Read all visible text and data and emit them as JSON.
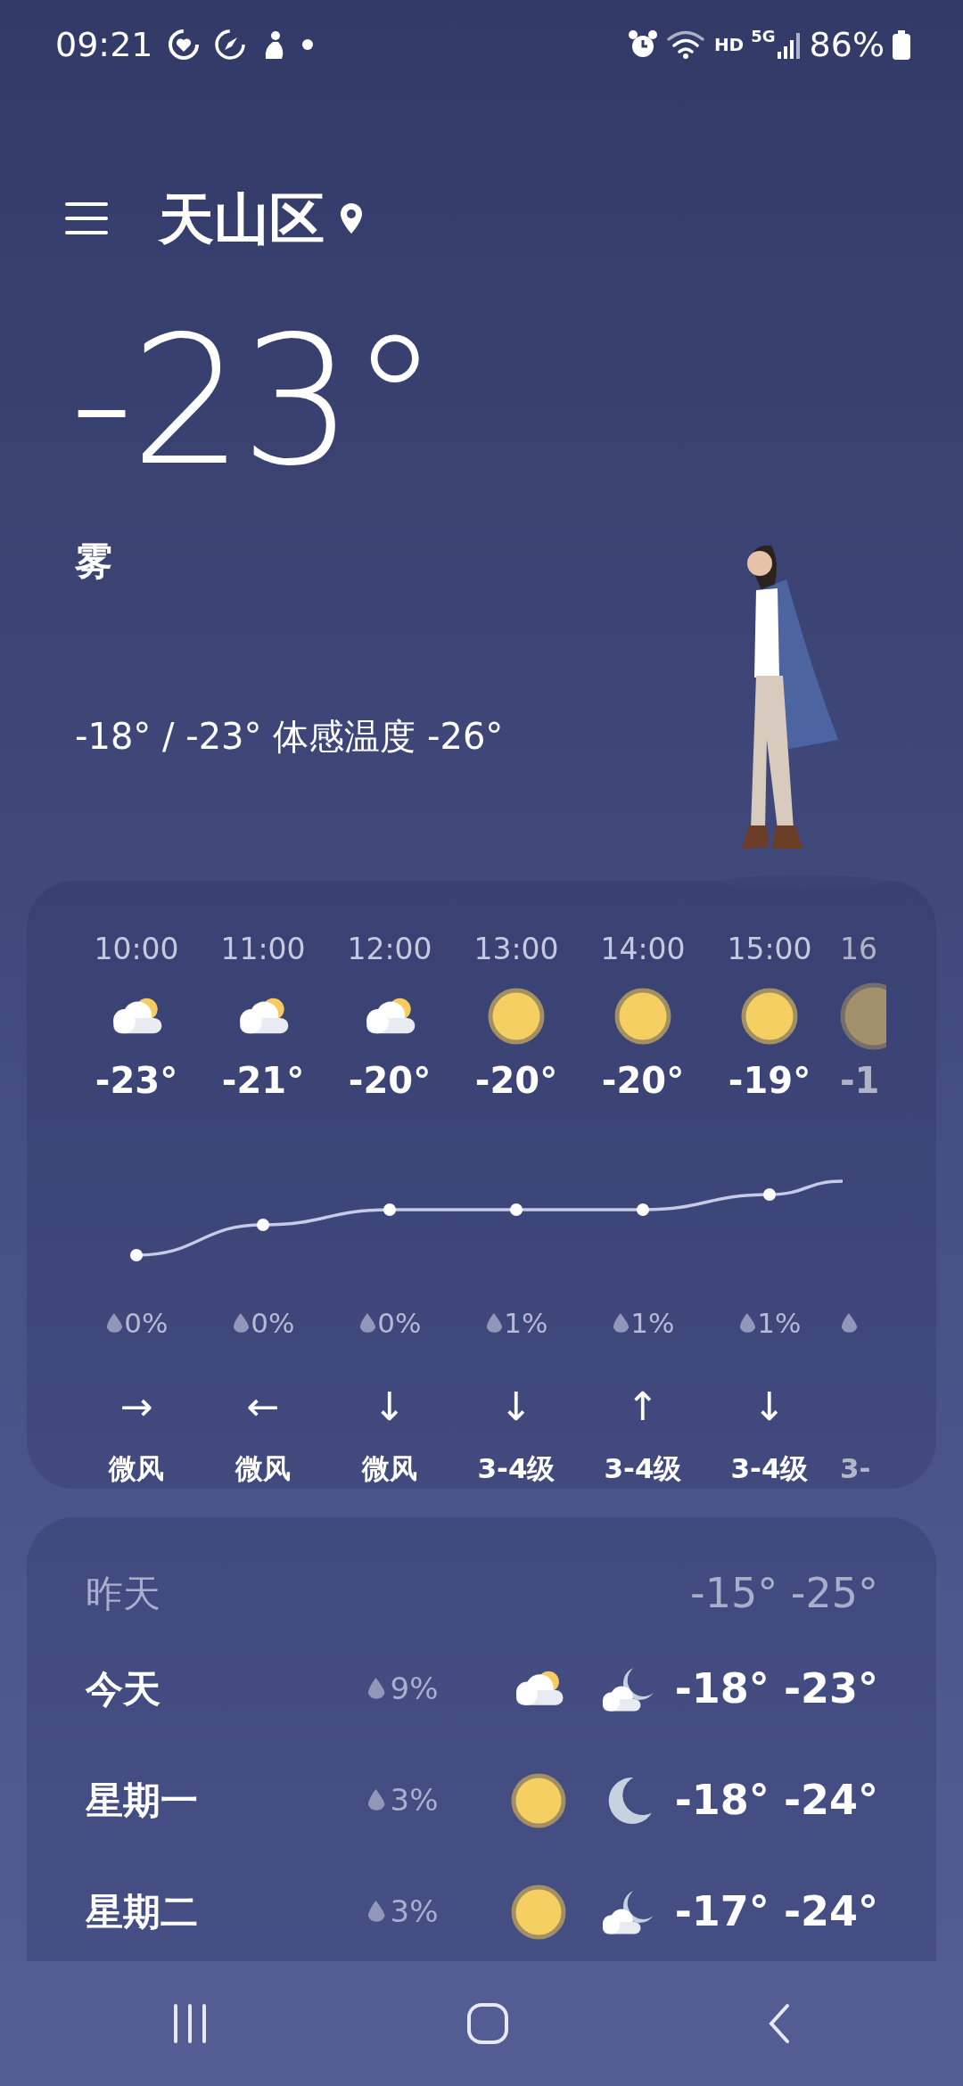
{
  "status_bar": {
    "time": "09:21",
    "network": "5G",
    "hd": "HD",
    "battery": "86%"
  },
  "header": {
    "location": "天山区"
  },
  "current": {
    "temperature": "-23°",
    "condition": "雾",
    "summary": "-18° / -23° 体感温度 -26°"
  },
  "hourly": [
    {
      "time": "10:00",
      "icon": {
        "kind": "partly_cloudy"
      },
      "temp": "-23°",
      "precip": "0%",
      "wind_arrow": "→",
      "wind": "微风"
    },
    {
      "time": "11:00",
      "icon": {
        "kind": "partly_cloudy"
      },
      "temp": "-21°",
      "precip": "0%",
      "wind_arrow": "←",
      "wind": "微风"
    },
    {
      "time": "12:00",
      "icon": {
        "kind": "partly_cloudy"
      },
      "temp": "-20°",
      "precip": "0%",
      "wind_arrow": "↓",
      "wind": "微风"
    },
    {
      "time": "13:00",
      "icon": {
        "kind": "sunny"
      },
      "temp": "-20°",
      "precip": "1%",
      "wind_arrow": "↓",
      "wind": "3-4级"
    },
    {
      "time": "14:00",
      "icon": {
        "kind": "sunny"
      },
      "temp": "-20°",
      "precip": "1%",
      "wind_arrow": "↑",
      "wind": "3-4级"
    },
    {
      "time": "15:00",
      "icon": {
        "kind": "sunny"
      },
      "temp": "-19°",
      "precip": "1%",
      "wind_arrow": "↓",
      "wind": "3-4级"
    },
    {
      "time": "16",
      "icon": {
        "kind": "sunny"
      },
      "temp": "-1",
      "wind": "3-"
    }
  ],
  "daily": [
    {
      "day": "昨天",
      "past": true,
      "temps": "-15° -25°"
    },
    {
      "day": "今天",
      "past": false,
      "precip": "9%",
      "icons": [
        {
          "kind": "partly_cloudy"
        },
        {
          "kind": "moon_cloudy"
        }
      ],
      "temps": "-18° -23°"
    },
    {
      "day": "星期一",
      "past": false,
      "precip": "3%",
      "icons": [
        {
          "kind": "sunny"
        },
        {
          "kind": "moon"
        }
      ],
      "temps": "-18° -24°"
    },
    {
      "day": "星期二",
      "past": false,
      "precip": "3%",
      "icons": [
        {
          "kind": "sunny"
        },
        {
          "kind": "moon_cloudy"
        }
      ],
      "temps": "-17° -24°"
    }
  ]
}
